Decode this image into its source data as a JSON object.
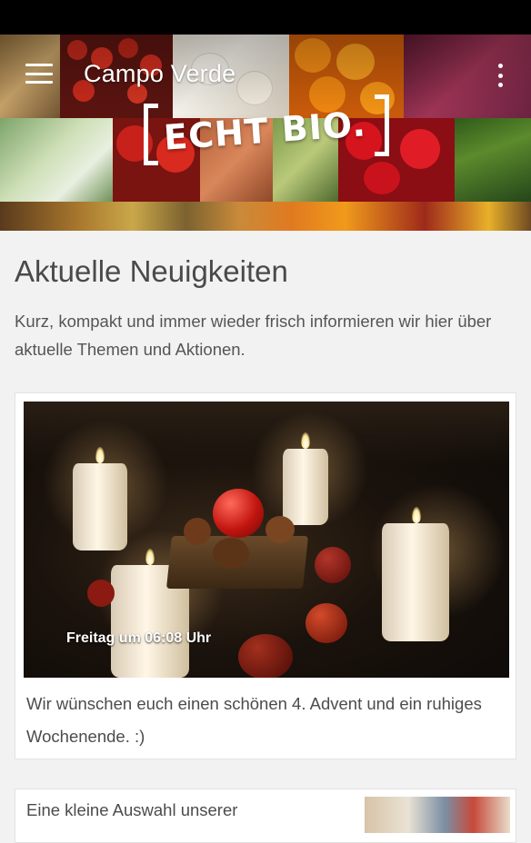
{
  "app": {
    "title": "Campo Verde",
    "menu_icon": "hamburger-menu-icon",
    "overflow_icon": "more-vertical-icon"
  },
  "header": {
    "logo_text": "ECHT BIO.",
    "background": "vegetable-mosaic"
  },
  "news": {
    "title": "Aktuelle Neuigkeiten",
    "intro": "Kurz, kompakt und immer wieder frisch informieren wir hier über aktuelle Themen und Aktionen.",
    "posts": [
      {
        "timestamp": "Freitag um 06:08 Uhr",
        "text": "Wir wünschen euch einen schönen 4. Advent und ein ruhiges Wochenende. :)"
      },
      {
        "text": "Eine kleine Auswahl unserer"
      }
    ]
  },
  "colors": {
    "status_bar": "#000000",
    "background": "#f2f2f2",
    "card": "#ffffff",
    "text": "#4c4c4c"
  }
}
